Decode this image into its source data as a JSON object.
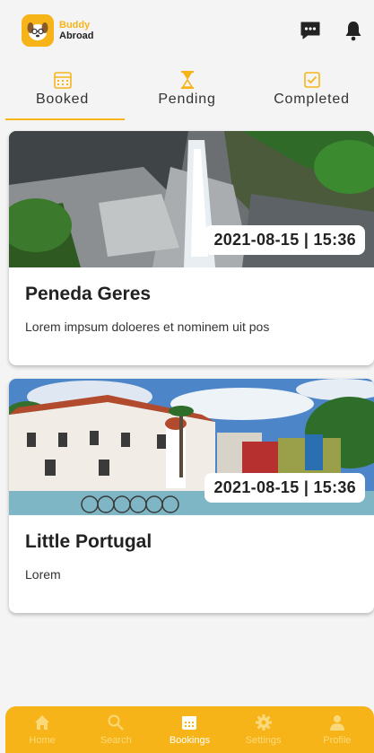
{
  "app": {
    "logo_line1": "Buddy",
    "logo_line2": "Abroad",
    "brand_color": "#f6b419"
  },
  "header": {
    "chat_icon": "chat-bubble-icon",
    "notification_icon": "bell-icon"
  },
  "tabs": [
    {
      "label": "Booked",
      "icon": "calendar-icon",
      "active": true
    },
    {
      "label": "Pending",
      "icon": "hourglass-icon",
      "active": false
    },
    {
      "label": "Completed",
      "icon": "checkbox-icon",
      "active": false
    }
  ],
  "bookings": [
    {
      "datetime": "2021-08-15 | 15:36",
      "title": "Peneda Geres",
      "description": "Lorem impsum doloeres et nominem uit pos"
    },
    {
      "datetime": "2021-08-15 | 15:36",
      "title": "Little Portugal",
      "description": "Lorem"
    }
  ],
  "bottom_nav": [
    {
      "label": "Home",
      "icon": "home-icon",
      "active": false
    },
    {
      "label": "Search",
      "icon": "search-icon",
      "active": false
    },
    {
      "label": "Bookings",
      "icon": "calendar-icon",
      "active": true
    },
    {
      "label": "Settings",
      "icon": "gear-icon",
      "active": false
    },
    {
      "label": "Profile",
      "icon": "person-icon",
      "active": false
    }
  ]
}
